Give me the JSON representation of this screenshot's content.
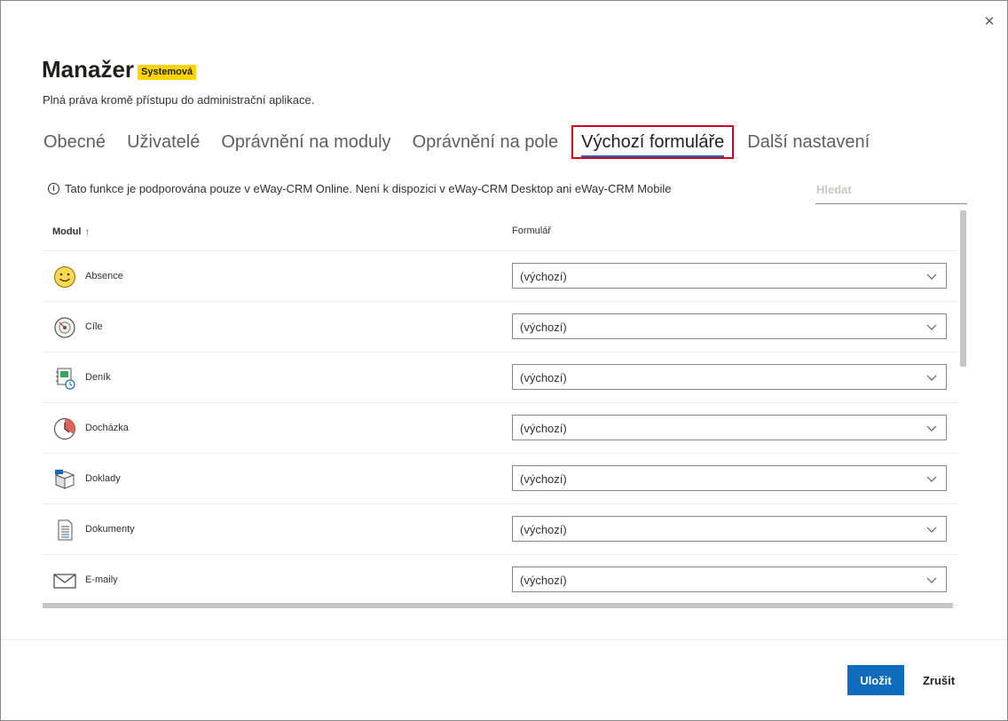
{
  "dialog": {
    "title": "Manažer",
    "badge": "Systemová",
    "subtitle": "Plná práva kromě přístupu do administrační aplikace.",
    "close_icon": "close-icon"
  },
  "tabs": [
    {
      "label": "Obecné",
      "active": false
    },
    {
      "label": "Uživatelé",
      "active": false
    },
    {
      "label": "Oprávnění na moduly",
      "active": false
    },
    {
      "label": "Oprávnění na pole",
      "active": false
    },
    {
      "label": "Výchozí formuláře",
      "active": true
    },
    {
      "label": "Další nastavení",
      "active": false
    }
  ],
  "notice": {
    "icon": "info-icon",
    "text": "Tato funkce je podporována pouze v eWay-CRM Online. Není k dispozici v eWay-CRM Desktop ani eWay-CRM Mobile"
  },
  "search": {
    "placeholder": "Hledat",
    "value": ""
  },
  "table": {
    "headers": {
      "module": "Modul",
      "form": "Formulář"
    },
    "rows": [
      {
        "module": "Absence",
        "icon": "smiley-icon",
        "form": "(výchozí)"
      },
      {
        "module": "Cíle",
        "icon": "target-icon",
        "form": "(výchozí)"
      },
      {
        "module": "Deník",
        "icon": "journal-icon",
        "form": "(výchozí)"
      },
      {
        "module": "Docházka",
        "icon": "attendance-clock-icon",
        "form": "(výchozí)"
      },
      {
        "module": "Doklady",
        "icon": "box-icon",
        "form": "(výchozí)"
      },
      {
        "module": "Dokumenty",
        "icon": "document-icon",
        "form": "(výchozí)"
      },
      {
        "module": "E-maily",
        "icon": "envelope-icon",
        "form": "(výchozí)"
      }
    ]
  },
  "footer": {
    "save_label": "Uložit",
    "cancel_label": "Zrušit"
  },
  "colors": {
    "accent": "#0f6cbd",
    "badge": "#ffd400",
    "highlight_border": "#d0021b"
  }
}
